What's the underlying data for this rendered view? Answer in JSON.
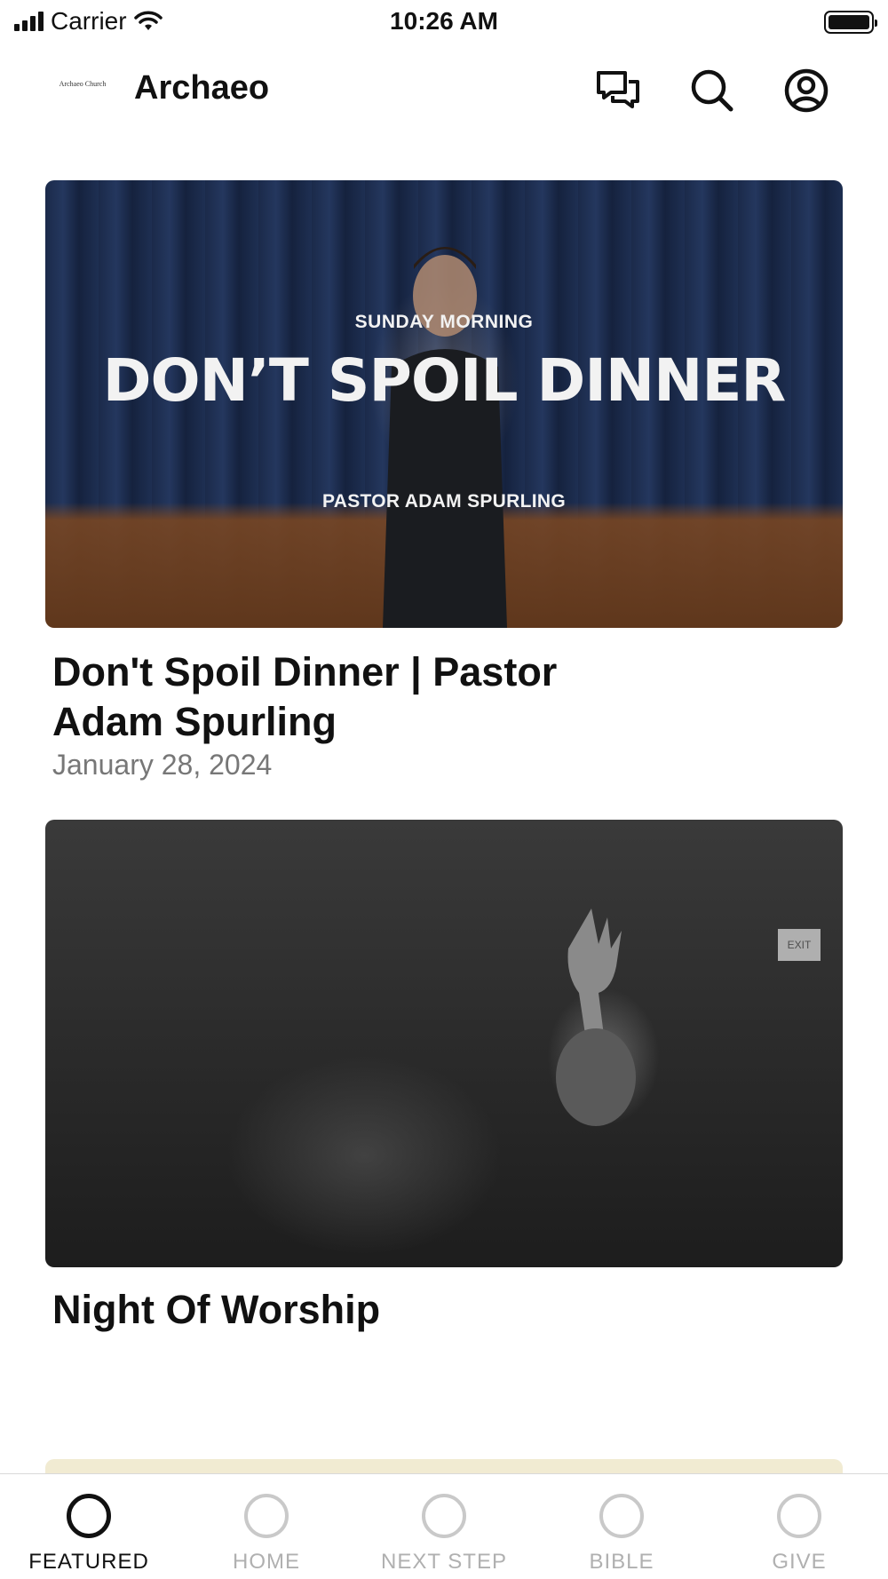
{
  "status_bar": {
    "carrier": "Carrier",
    "time": "10:26 AM"
  },
  "header": {
    "logo_text": "Archaeo Church",
    "title": "Archaeo",
    "icons": [
      "chat-icon",
      "search-icon",
      "profile-icon"
    ]
  },
  "feed": {
    "items": [
      {
        "overlay_kicker": "SUNDAY MORNING",
        "overlay_title": "DON’T SPOIL DINNER",
        "overlay_byline": "PASTOR ADAM SPURLING",
        "title": "Don't Spoil Dinner | Pastor Adam Spurling",
        "date": "January 28, 2024"
      },
      {
        "exit_sign": "EXIT",
        "title": "Night Of Worship"
      }
    ]
  },
  "tab_bar": {
    "tabs": [
      {
        "label": "FEATURED",
        "active": true
      },
      {
        "label": "HOME",
        "active": false
      },
      {
        "label": "NEXT STEP",
        "active": false
      },
      {
        "label": "BIBLE",
        "active": false
      },
      {
        "label": "GIVE",
        "active": false
      }
    ]
  },
  "colors": {
    "active_tab": "#111111",
    "inactive_tab": "#b0b0b0",
    "date_text": "#777777",
    "peek_card": "#f1ebd2"
  }
}
